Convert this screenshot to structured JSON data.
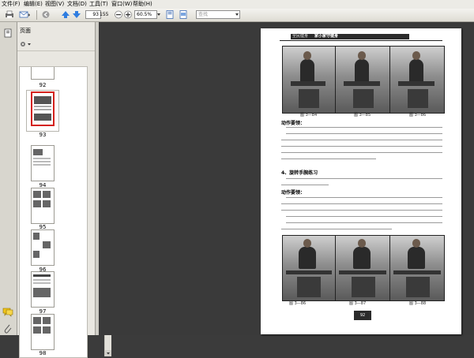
{
  "menu": [
    "文件(F)",
    "编辑(E)",
    "视图(V)",
    "文档(D)",
    "工具(T)",
    "窗口(W)",
    "帮助(H)"
  ],
  "toolbar": {
    "current_page": "93",
    "total_pages": "155",
    "zoom": "60.5%",
    "search_placeholder": "查找"
  },
  "panel": {
    "title": "页面"
  },
  "thumbnails": [
    "92",
    "93",
    "94",
    "95",
    "96",
    "97",
    "98"
  ],
  "selected_thumbnail": "93",
  "document": {
    "header_left": "全民健身",
    "header_title": "家小家守健身",
    "captions_row1": [
      "图 3—84",
      "图 3—85",
      "图 3—86"
    ],
    "section_label": "动作要领：",
    "heading": "4、旋转手腕练习",
    "sub_label": "动作要领：",
    "captions_row2": [
      "图 3—86",
      "图 3—87",
      "图 3—88"
    ],
    "page_number": "92"
  }
}
